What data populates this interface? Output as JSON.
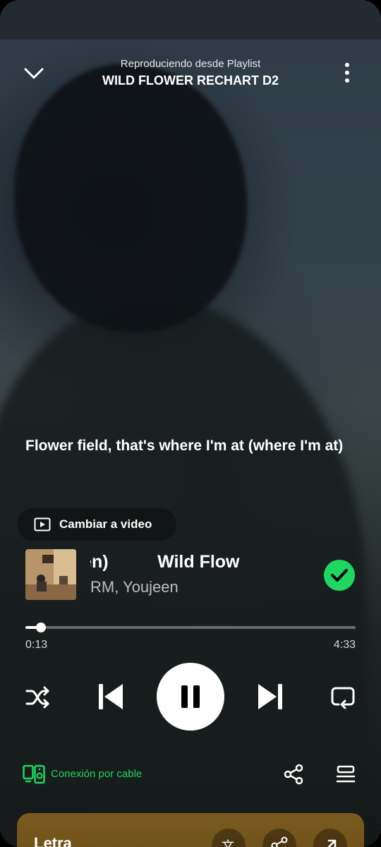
{
  "header": {
    "subtitle": "Reproduciendo desde Playlist",
    "title": "WILD FLOWER RECHART D2"
  },
  "lyric_line": "Flower field, that's where I'm at (where I'm at)",
  "video_toggle": {
    "label": "Cambiar a video"
  },
  "track": {
    "title_visible": "ujeen)          Wild Flow",
    "artist": "RM, Youjeen",
    "liked": true
  },
  "progress": {
    "current": "0:13",
    "total": "4:33",
    "fraction": 0.048
  },
  "device": {
    "label": "Conexión por cable"
  },
  "lyrics_card": {
    "label": "Letra"
  },
  "colors": {
    "accent_green": "#1ed760",
    "lyrics_card": "#7a5a1e"
  },
  "icons": [
    "chevron-down-icon",
    "more-vert-icon",
    "video-icon",
    "check-circle-icon",
    "shuffle-icon",
    "previous-icon",
    "pause-icon",
    "next-icon",
    "repeat-icon",
    "device-speaker-icon",
    "share-icon",
    "queue-icon",
    "translate-icon",
    "expand-icon"
  ]
}
